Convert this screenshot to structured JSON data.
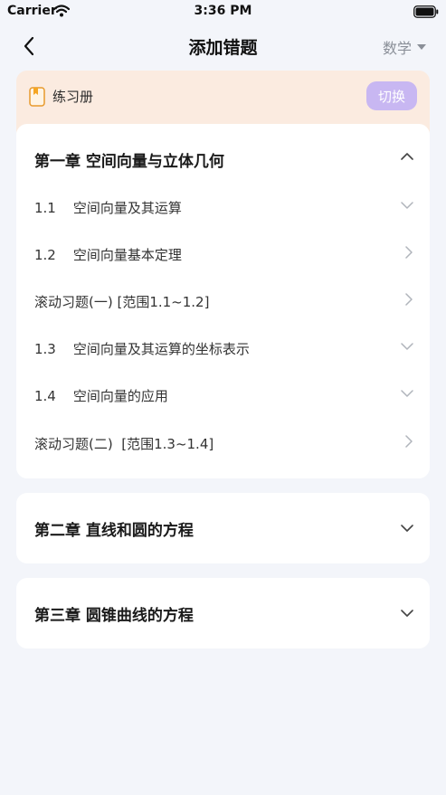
{
  "status_bar": {
    "carrier": "Carrier",
    "time": "3:36 PM"
  },
  "nav": {
    "title": "添加错题",
    "subject": "数学"
  },
  "book": {
    "label": "练习册",
    "switch_label": "切换"
  },
  "chapters": [
    {
      "title": "第一章 空间向量与立体几何",
      "expanded": true,
      "sections": [
        {
          "label": "1.1    空间向量及其运算",
          "chevron": "down"
        },
        {
          "label": "1.2    空间向量基本定理",
          "chevron": "right"
        },
        {
          "label": "滚动习题(一) [范围1.1~1.2]",
          "chevron": "right"
        },
        {
          "label": "1.3    空间向量及其运算的坐标表示",
          "chevron": "down"
        },
        {
          "label": "1.4    空间向量的应用",
          "chevron": "down"
        },
        {
          "label": "滚动习题(二)  [范围1.3~1.4]",
          "chevron": "right"
        }
      ]
    },
    {
      "title": "第二章 直线和圆的方程",
      "expanded": false
    },
    {
      "title": "第三章 圆锥曲线的方程",
      "expanded": false
    }
  ],
  "colors": {
    "background": "#f3f5fa",
    "book_bar": "#fbebe0",
    "switch_button": "#c8b7f2",
    "book_icon": "#f5a623"
  }
}
